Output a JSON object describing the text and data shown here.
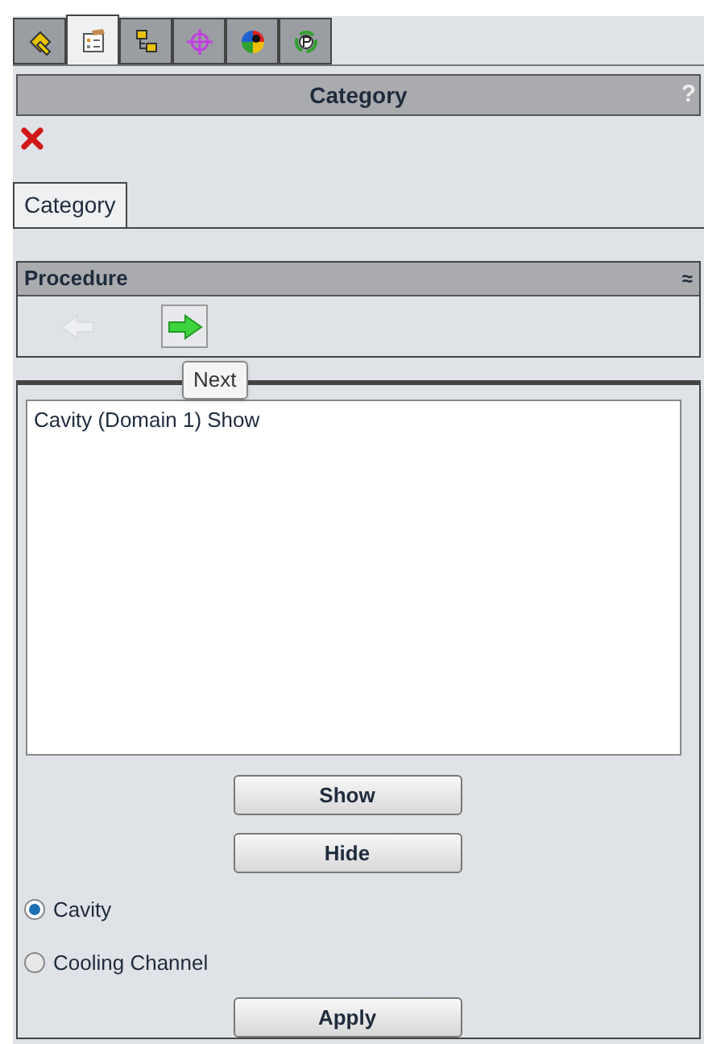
{
  "toolbar_tabs": [
    {
      "selected": false
    },
    {
      "selected": true
    },
    {
      "selected": false
    },
    {
      "selected": false
    },
    {
      "selected": false
    },
    {
      "selected": false
    }
  ],
  "panel": {
    "title": "Category",
    "help": "?"
  },
  "tabs": [
    {
      "label": "Category",
      "selected": true
    }
  ],
  "procedure": {
    "title": "Procedure",
    "collapse": "≈",
    "back": {
      "disabled": true
    },
    "next": {
      "disabled": false
    },
    "tooltip": "Next"
  },
  "list": {
    "items": [
      "Cavity (Domain 1) Show"
    ]
  },
  "buttons": [
    {
      "label": "Show"
    },
    {
      "label": "Hide"
    }
  ],
  "radios": [
    {
      "label": "Cavity",
      "selected": true
    },
    {
      "label": "Cooling Channel",
      "selected": false
    }
  ],
  "apply": {
    "label": "Apply"
  }
}
